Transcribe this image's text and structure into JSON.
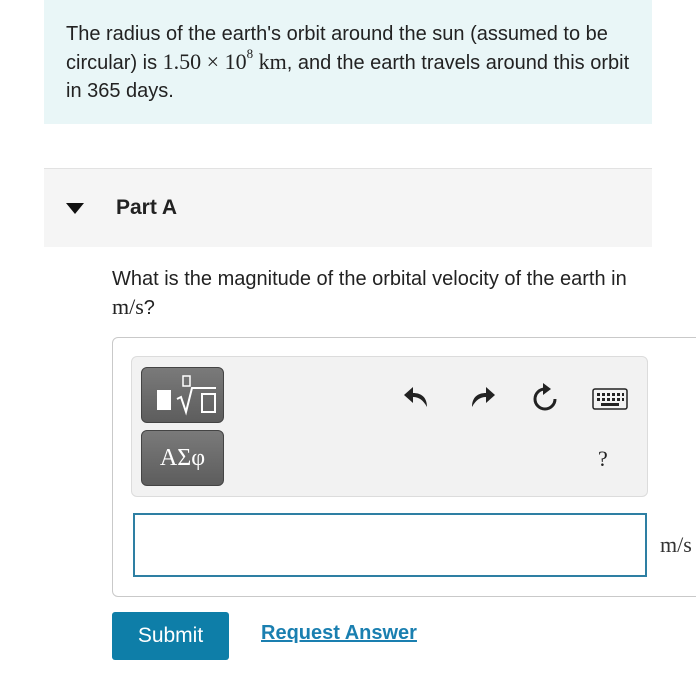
{
  "problem": {
    "text_before": "The radius of the earth's orbit around the sun (assumed to be circular) is ",
    "coef": "1.50",
    "times": "×",
    "base": "10",
    "exponent": "8",
    "unit": "km",
    "text_after": ", and the earth travels around this orbit in 365 days."
  },
  "part": {
    "title": "Part A",
    "question_text": "What is the magnitude of the orbital velocity of the earth in ",
    "question_unit": "m/s",
    "question_end": "?"
  },
  "toolbar": {
    "templates_icon": "templates-sqrt-icon",
    "greek_label": "ΑΣφ",
    "undo_icon": "undo-icon",
    "redo_icon": "redo-icon",
    "reset_icon": "reset-icon",
    "keyboard_icon": "keyboard-icon",
    "help_label": "?"
  },
  "answer": {
    "value": "",
    "unit": "m/s"
  },
  "actions": {
    "submit_label": "Submit",
    "request_answer_label": "Request Answer"
  },
  "colors": {
    "problem_bg": "#e9f6f7",
    "accent": "#0e7ea8",
    "link": "#1a7fb0",
    "input_border": "#2e7fa3"
  }
}
